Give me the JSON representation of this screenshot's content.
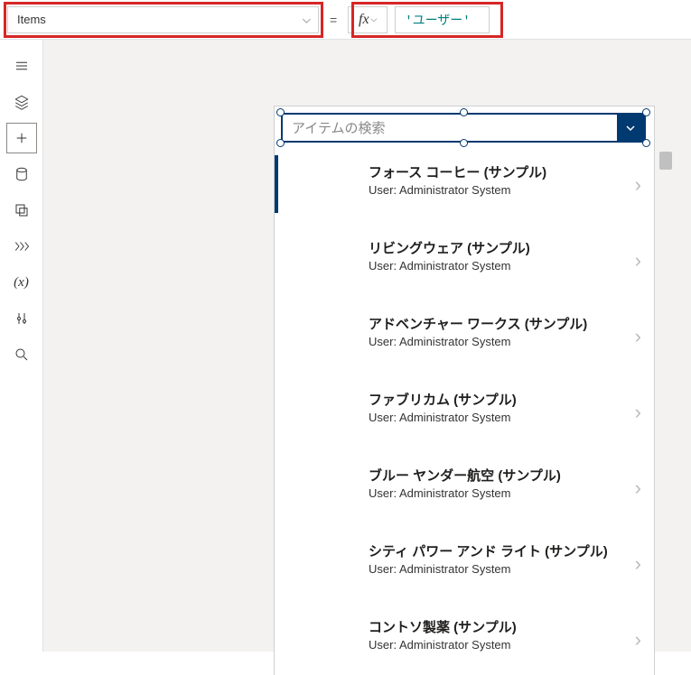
{
  "formula": {
    "property": "Items",
    "equals": "=",
    "fx_label": "fx",
    "value": "'ユーザー'"
  },
  "combo": {
    "placeholder": "アイテムの検索"
  },
  "items": [
    {
      "title": "フォース コーヒー (サンプル)",
      "subtitle": "User: Administrator System",
      "selected": true
    },
    {
      "title": "リビングウェア (サンプル)",
      "subtitle": "User: Administrator System",
      "selected": false
    },
    {
      "title": "アドベンチャー ワークス (サンプル)",
      "subtitle": "User: Administrator System",
      "selected": false
    },
    {
      "title": "ファブリカム (サンプル)",
      "subtitle": "User: Administrator System",
      "selected": false
    },
    {
      "title": "ブルー ヤンダー航空 (サンプル)",
      "subtitle": "User: Administrator System",
      "selected": false
    },
    {
      "title": "シティ パワー アンド ライト (サンプル)",
      "subtitle": "User: Administrator System",
      "selected": false
    },
    {
      "title": "コントソ製薬 (サンプル)",
      "subtitle": "User: Administrator System",
      "selected": false
    }
  ]
}
